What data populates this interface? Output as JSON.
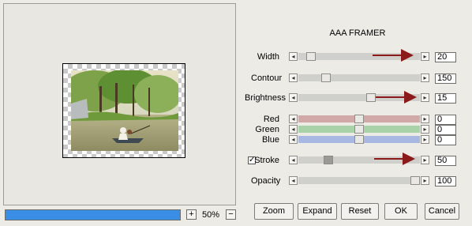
{
  "title": "AAA FRAMER",
  "zoom": {
    "plus": "+",
    "value": "50%",
    "minus": "−"
  },
  "progress_fraction": 1.0,
  "controls": [
    {
      "label": "Width",
      "value": "20",
      "position": 0.08,
      "track_color": "#cfcfcc",
      "annotated": true
    },
    {
      "label": "Contour",
      "value": "150",
      "position": 0.2,
      "track_color": "#cfcfcc",
      "annotated": false
    },
    {
      "label": "Brightness",
      "value": "15",
      "position": 0.56,
      "track_color": "#cfcfcc",
      "annotated": true
    },
    {
      "label": "Red",
      "value": "0",
      "position": 0.5,
      "track_color": "#d2a9a9",
      "annotated": false
    },
    {
      "label": "Green",
      "value": "0",
      "position": 0.5,
      "track_color": "#a9d2a9",
      "annotated": false
    },
    {
      "label": "Blue",
      "value": "0",
      "position": 0.5,
      "track_color": "#a9b8e0",
      "annotated": false
    },
    {
      "label": "Stroke",
      "value": "50",
      "position": 0.23,
      "track_color": "#cfcfcc",
      "annotated": true,
      "checked": true
    },
    {
      "label": "Opacity",
      "value": "100",
      "position": 1.0,
      "track_color": "#cfcfcc",
      "annotated": false
    }
  ],
  "buttons": {
    "zoom": "Zoom",
    "expand": "Expand",
    "reset": "Reset",
    "ok": "OK",
    "cancel": "Cancel"
  },
  "arrow_glyphs": {
    "left": "◂",
    "right": "▸"
  },
  "checkbox_glyph": "✓",
  "colors": {
    "progress": "#3a8ee6",
    "annotation_arrow": "#8b1a1a"
  }
}
